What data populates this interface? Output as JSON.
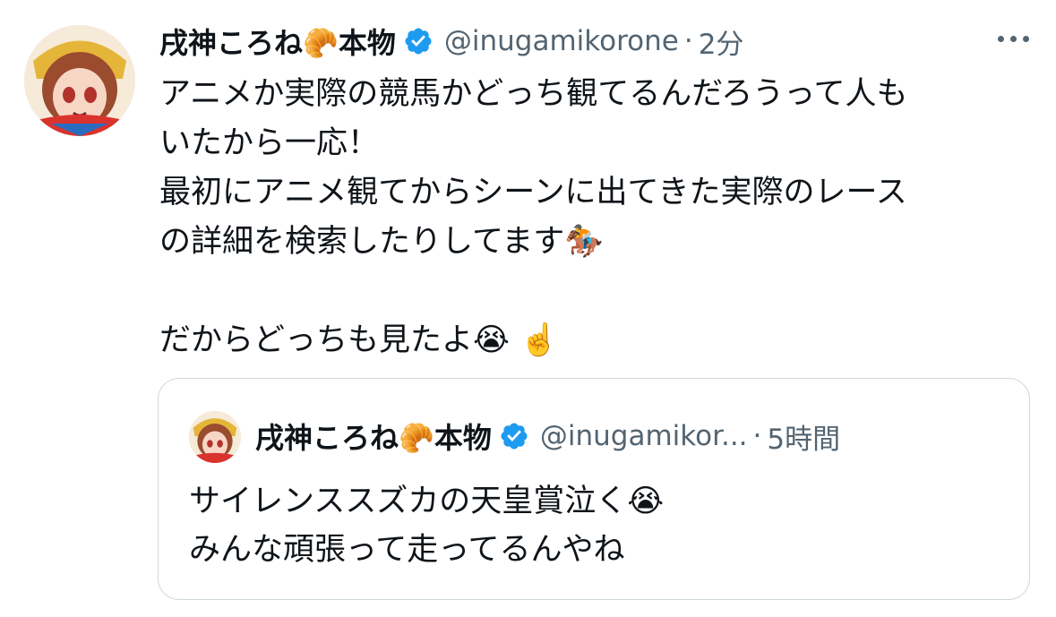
{
  "tweet": {
    "display_name": "戌神ころね🥐本物",
    "handle": "@inugamikorone",
    "separator": "·",
    "time": "2分",
    "text": "アニメか実際の競馬かどっち観てるんだろうって人も\nいたから一応！\n最初にアニメ観てからシーンに出てきた実際のレース\nの詳細を検索したりしてます🏇\n\nだからどっちも見たよ😭 ☝️"
  },
  "quoted_tweet": {
    "display_name": "戌神ころね🥐本物",
    "handle": "@inugamikor...",
    "separator": "·",
    "time": "5時間",
    "text": "サイレンススズカの天皇賞泣く😭\nみんな頑張って走ってるんやね"
  },
  "colors": {
    "verified_blue": "#1d9bf0",
    "secondary_text": "#536471",
    "border": "#cfd9de"
  },
  "icons": {
    "verified": "verified-badge-icon",
    "more": "more-options-icon"
  }
}
